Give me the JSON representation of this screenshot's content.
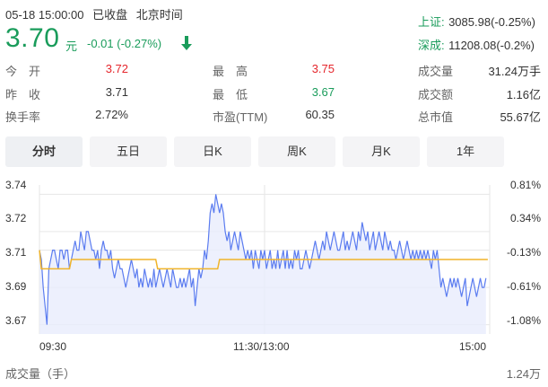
{
  "status": {
    "datetime": "05-18 15:00:00",
    "market_state": "已收盘",
    "timezone": "北京时间"
  },
  "quote": {
    "price": "3.70",
    "currency": "元",
    "change": "-0.01 (-0.27%)",
    "direction_icon": "down-arrow-icon",
    "color_down": "#1a9c5b",
    "color_up": "#e5262c"
  },
  "indices": [
    {
      "label": "上证:",
      "value": "3085.98(-0.25%)"
    },
    {
      "label": "深成:",
      "value": "11208.08(-0.2%)"
    }
  ],
  "stats": {
    "col1": [
      {
        "label": "今　开",
        "value": "3.72",
        "color": "red"
      },
      {
        "label": "昨　收",
        "value": "3.71",
        "color": "neutral"
      },
      {
        "label": "换手率",
        "value": "2.72%",
        "color": "neutral"
      }
    ],
    "col2": [
      {
        "label": "最　高",
        "value": "3.75",
        "color": "red"
      },
      {
        "label": "最　低",
        "value": "3.67",
        "color": "green"
      },
      {
        "label": "市盈(TTM)",
        "value": "60.35",
        "color": "neutral"
      }
    ],
    "col3": [
      {
        "label": "成交量",
        "value": "31.24万手"
      },
      {
        "label": "成交额",
        "value": "1.16亿"
      },
      {
        "label": "总市值",
        "value": "55.67亿"
      }
    ]
  },
  "tabs": [
    {
      "label": "分时",
      "active": true
    },
    {
      "label": "五日",
      "active": false
    },
    {
      "label": "日K",
      "active": false
    },
    {
      "label": "周K",
      "active": false
    },
    {
      "label": "月K",
      "active": false
    },
    {
      "label": "1年",
      "active": false
    }
  ],
  "chart_data": {
    "type": "line",
    "title": "",
    "y_left_ticks": [
      "3.74",
      "3.72",
      "3.71",
      "3.69",
      "3.67"
    ],
    "y_right_ticks": [
      "0.81%",
      "0.34%",
      "-0.13%",
      "-0.61%",
      "-1.08%"
    ],
    "ylim": [
      3.665,
      3.745
    ],
    "x_tick_labels": [
      "09:30",
      "11:30/13:00",
      "15:00"
    ],
    "x_points": 241,
    "prev_close": 3.71,
    "colors": {
      "price": "#5b7cf0",
      "average": "#f0b429",
      "fill": "#e8ecfc",
      "grid": "#e6e6e6"
    },
    "series": [
      {
        "kind": "price",
        "values": [
          3.71,
          3.705,
          3.69,
          3.68,
          3.67,
          3.7,
          3.705,
          3.71,
          3.71,
          3.705,
          3.7,
          3.71,
          3.71,
          3.705,
          3.71,
          3.71,
          3.7,
          3.705,
          3.71,
          3.715,
          3.71,
          3.71,
          3.72,
          3.715,
          3.71,
          3.72,
          3.72,
          3.715,
          3.71,
          3.71,
          3.705,
          3.71,
          3.7,
          3.71,
          3.715,
          3.71,
          3.71,
          3.705,
          3.71,
          3.7,
          3.695,
          3.7,
          3.705,
          3.7,
          3.7,
          3.695,
          3.69,
          3.695,
          3.7,
          3.705,
          3.7,
          3.695,
          3.7,
          3.69,
          3.695,
          3.69,
          3.7,
          3.695,
          3.69,
          3.695,
          3.69,
          3.7,
          3.69,
          3.695,
          3.7,
          3.695,
          3.69,
          3.695,
          3.7,
          3.695,
          3.69,
          3.7,
          3.695,
          3.69,
          3.69,
          3.695,
          3.69,
          3.695,
          3.69,
          3.695,
          3.7,
          3.69,
          3.695,
          3.68,
          3.69,
          3.7,
          3.695,
          3.7,
          3.71,
          3.705,
          3.715,
          3.73,
          3.735,
          3.73,
          3.74,
          3.735,
          3.73,
          3.735,
          3.73,
          3.72,
          3.715,
          3.72,
          3.71,
          3.715,
          3.72,
          3.715,
          3.71,
          3.72,
          3.715,
          3.71,
          3.705,
          3.71,
          3.705,
          3.71,
          3.7,
          3.71,
          3.705,
          3.7,
          3.71,
          3.705,
          3.71,
          3.7,
          3.705,
          3.71,
          3.7,
          3.705,
          3.7,
          3.71,
          3.7,
          3.705,
          3.71,
          3.7,
          3.71,
          3.7,
          3.705,
          3.7,
          3.71,
          3.705,
          3.71,
          3.7,
          3.7,
          3.705,
          3.71,
          3.705,
          3.7,
          3.705,
          3.71,
          3.715,
          3.71,
          3.705,
          3.71,
          3.715,
          3.71,
          3.72,
          3.715,
          3.71,
          3.715,
          3.72,
          3.715,
          3.71,
          3.71,
          3.715,
          3.72,
          3.71,
          3.715,
          3.71,
          3.715,
          3.72,
          3.715,
          3.71,
          3.72,
          3.715,
          3.725,
          3.72,
          3.715,
          3.72,
          3.71,
          3.715,
          3.72,
          3.71,
          3.715,
          3.72,
          3.715,
          3.71,
          3.72,
          3.715,
          3.71,
          3.715,
          3.71,
          3.71,
          3.705,
          3.71,
          3.715,
          3.71,
          3.705,
          3.71,
          3.715,
          3.71,
          3.705,
          3.71,
          3.705,
          3.71,
          3.705,
          3.71,
          3.705,
          3.71,
          3.705,
          3.71,
          3.705,
          3.7,
          3.71,
          3.705,
          3.71,
          3.7,
          3.69,
          3.695,
          3.69,
          3.685,
          3.69,
          3.695,
          3.69,
          3.695,
          3.69,
          3.695,
          3.69,
          3.685,
          3.69,
          3.695,
          3.68,
          3.685,
          3.69,
          3.695,
          3.69,
          3.685,
          3.69,
          3.695,
          3.69,
          3.69,
          3.695
        ]
      },
      {
        "kind": "average",
        "values": [
          3.71,
          3.7,
          3.7,
          3.7,
          3.7,
          3.7,
          3.7,
          3.7,
          3.7,
          3.7,
          3.7,
          3.7,
          3.7,
          3.7,
          3.7,
          3.7,
          3.7,
          3.705,
          3.705,
          3.705,
          3.705,
          3.705,
          3.705,
          3.705,
          3.705,
          3.705,
          3.705,
          3.705,
          3.705,
          3.705,
          3.705,
          3.705,
          3.705,
          3.705,
          3.705,
          3.705,
          3.705,
          3.705,
          3.705,
          3.705,
          3.705,
          3.705,
          3.705,
          3.705,
          3.705,
          3.705,
          3.705,
          3.705,
          3.705,
          3.705,
          3.705,
          3.705,
          3.705,
          3.705,
          3.705,
          3.705,
          3.705,
          3.705,
          3.705,
          3.705,
          3.705,
          3.705,
          3.705,
          3.7,
          3.7,
          3.7,
          3.7,
          3.7,
          3.7,
          3.7,
          3.7,
          3.7,
          3.7,
          3.7,
          3.7,
          3.7,
          3.7,
          3.7,
          3.7,
          3.7,
          3.7,
          3.7,
          3.7,
          3.7,
          3.7,
          3.7,
          3.7,
          3.7,
          3.7,
          3.7,
          3.7,
          3.7,
          3.7,
          3.7,
          3.7,
          3.7,
          3.705,
          3.705,
          3.705,
          3.705,
          3.705,
          3.705,
          3.705,
          3.705,
          3.705,
          3.705,
          3.705,
          3.705,
          3.705,
          3.705,
          3.705,
          3.705,
          3.705,
          3.705,
          3.705,
          3.705,
          3.705,
          3.705,
          3.705,
          3.705,
          3.705,
          3.705,
          3.705,
          3.705,
          3.705,
          3.705,
          3.705,
          3.705,
          3.705,
          3.705,
          3.705,
          3.705,
          3.705,
          3.705,
          3.705,
          3.705,
          3.705,
          3.705,
          3.705,
          3.705,
          3.705,
          3.705,
          3.705,
          3.705,
          3.705,
          3.705,
          3.705,
          3.705,
          3.705,
          3.705,
          3.705,
          3.705,
          3.705,
          3.705,
          3.705,
          3.705,
          3.705,
          3.705,
          3.705,
          3.705,
          3.705,
          3.705,
          3.705,
          3.705,
          3.705,
          3.705,
          3.705,
          3.705,
          3.705,
          3.705,
          3.705,
          3.705,
          3.705,
          3.705,
          3.705,
          3.705,
          3.705,
          3.705,
          3.705,
          3.705,
          3.705,
          3.705,
          3.705,
          3.705,
          3.705,
          3.705,
          3.705,
          3.705,
          3.705,
          3.705,
          3.705,
          3.705,
          3.705,
          3.705,
          3.705,
          3.705,
          3.705,
          3.705,
          3.705,
          3.705,
          3.705,
          3.705,
          3.705,
          3.705,
          3.705,
          3.705,
          3.705,
          3.705,
          3.705,
          3.705,
          3.705,
          3.705,
          3.705,
          3.705,
          3.705,
          3.705,
          3.705,
          3.705,
          3.705,
          3.705,
          3.705,
          3.705,
          3.705,
          3.705,
          3.705,
          3.705,
          3.705,
          3.705,
          3.705,
          3.705,
          3.705,
          3.705,
          3.705,
          3.705,
          3.705,
          3.705,
          3.705,
          3.705,
          3.705,
          3.705
        ]
      }
    ]
  },
  "volume": {
    "label": "成交量（手）",
    "max": "1.24万"
  }
}
